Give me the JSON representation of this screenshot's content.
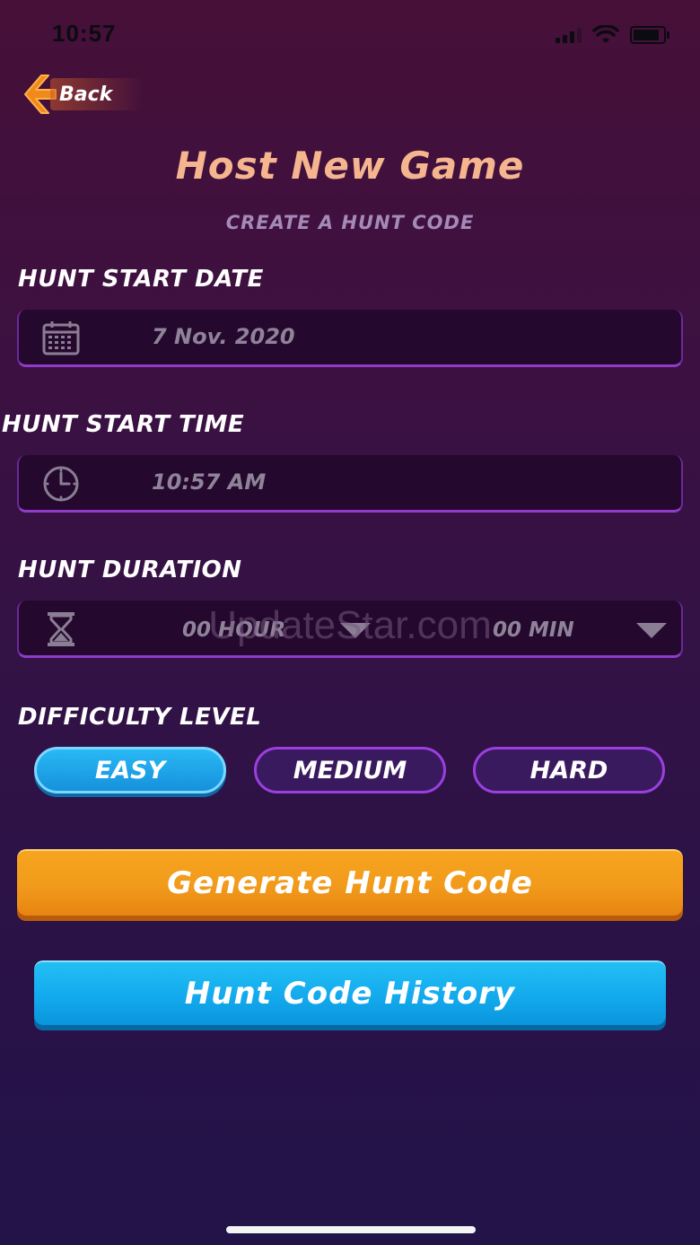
{
  "status_bar": {
    "time": "10:57"
  },
  "back": {
    "label": "Back"
  },
  "header": {
    "title": "Host New Game",
    "subtitle": "CREATE A HUNT CODE"
  },
  "date": {
    "label": "HUNT START DATE",
    "value": "7 Nov. 2020",
    "icon": "calendar-icon"
  },
  "time": {
    "label": "HUNT START TIME",
    "value": "10:57 AM",
    "icon": "clock-icon"
  },
  "duration": {
    "label": "HUNT DURATION",
    "hour": "00 HOUR",
    "min": "00 MIN",
    "icon": "hourglass-icon"
  },
  "difficulty": {
    "label": "DIFFICULTY LEVEL",
    "options": [
      "EASY",
      "MEDIUM",
      "HARD"
    ],
    "selected": "EASY"
  },
  "buttons": {
    "generate": "Generate Hunt Code",
    "history": "Hunt Code History"
  },
  "watermark": "UpdateStar.com",
  "colors": {
    "accent_orange": "#f19a1b",
    "accent_blue": "#12a8ec",
    "field_border": "#8f3cc8",
    "title": "#f5b58e"
  }
}
